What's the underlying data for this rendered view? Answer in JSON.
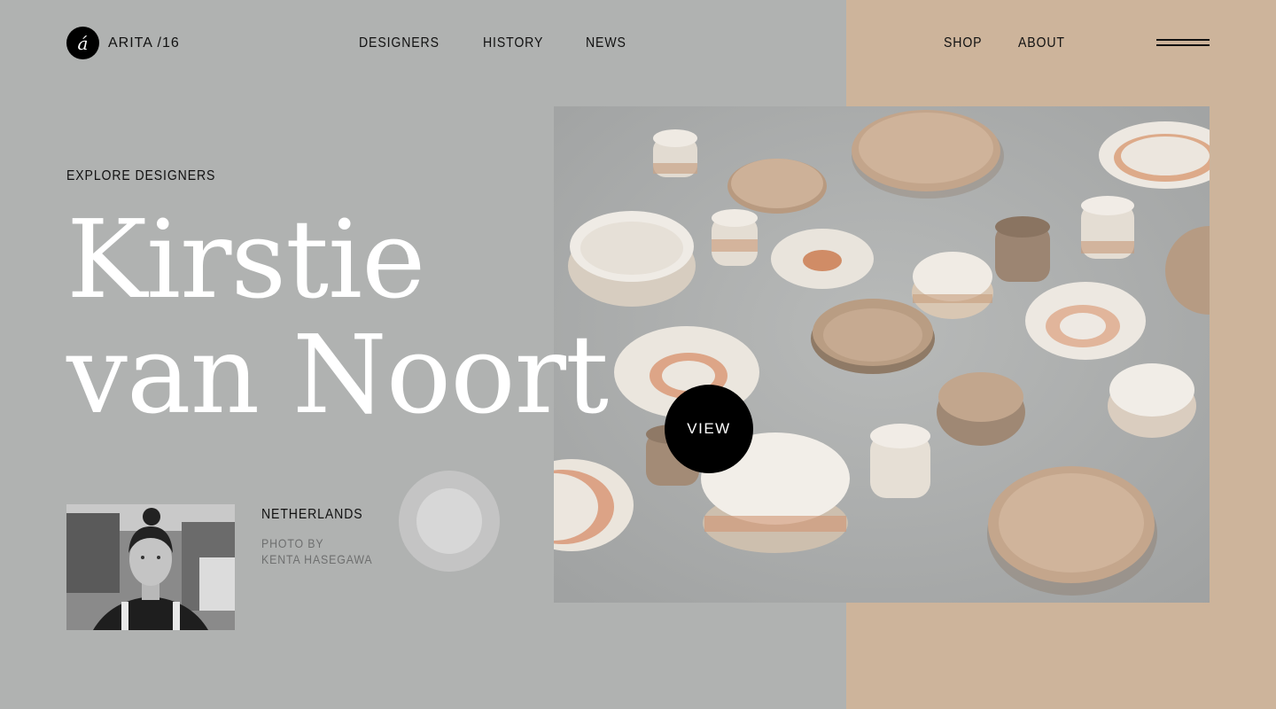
{
  "brand": {
    "logo_glyph": "á",
    "name": "ARITA /16"
  },
  "nav": {
    "designers": "DESIGNERS",
    "history": "HISTORY",
    "news": "NEWS",
    "shop": "SHOP",
    "about": "ABOUT"
  },
  "hero": {
    "eyebrow": "EXPLORE DESIGNERS",
    "name_line1": "Kirstie",
    "name_line2": "van Noort",
    "view_label": "VIEW"
  },
  "designer": {
    "country": "NETHERLANDS",
    "photo_credit_line1": "PHOTO BY",
    "photo_credit_line2": "KENTA HASEGAWA"
  },
  "colors": {
    "background": "#b0b2b1",
    "accent_panel": "#cdb49b",
    "view_button": "#000000",
    "headline": "#ffffff"
  }
}
